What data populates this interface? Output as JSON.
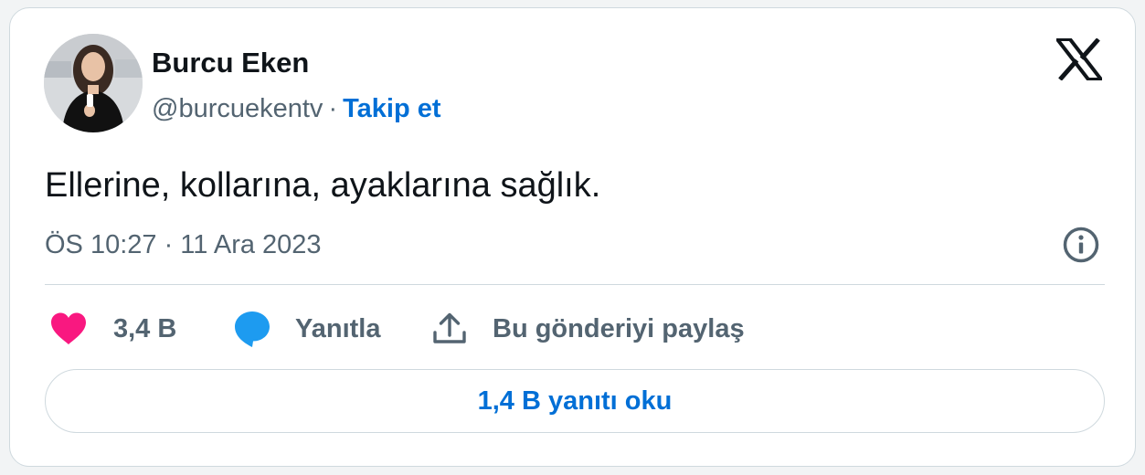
{
  "author": {
    "name": "Burcu Eken",
    "handle": "@burcuekentv",
    "separator": "·",
    "follow_label": "Takip et"
  },
  "tweet": {
    "text": "Ellerine, kollarına, ayaklarına sağlık.",
    "timestamp": "ÖS 10:27 · 11 Ara 2023"
  },
  "actions": {
    "likes_count": "3,4 B",
    "reply_label": "Yanıtla",
    "share_label": "Bu gönderiyi paylaş"
  },
  "read_replies_label": "1,4 B yanıtı oku",
  "icons": {
    "brand": "x-logo-icon",
    "info": "info-icon",
    "like": "heart-icon",
    "reply": "speech-bubble-icon",
    "share": "share-upload-icon"
  },
  "colors": {
    "link_blue": "#006fd6",
    "like_pink": "#f91880",
    "reply_blue": "#1d9bf0",
    "secondary_text": "#536471",
    "primary_text": "#0f1419",
    "border": "#cfd9de"
  }
}
